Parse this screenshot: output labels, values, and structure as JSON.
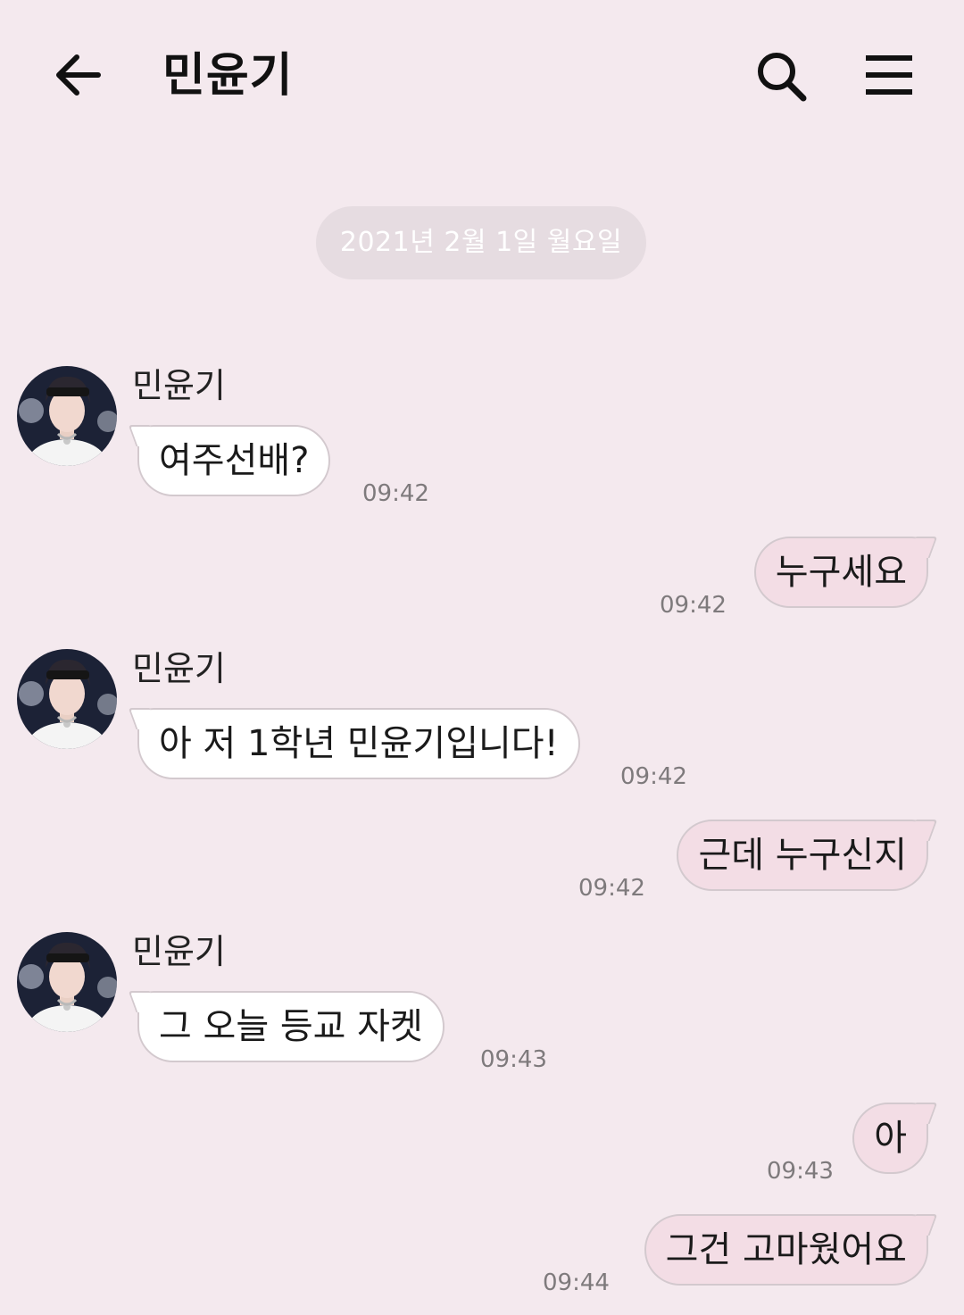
{
  "header": {
    "title": "민윤기",
    "back_icon": "arrow-left-icon",
    "search_icon": "search-icon",
    "menu_icon": "hamburger-menu-icon"
  },
  "date_divider": "2021년 2월 1일 월요일",
  "messages": [
    {
      "direction": "incoming",
      "sender": "민윤기",
      "text": "여주선배?",
      "time": "09:42"
    },
    {
      "direction": "outgoing",
      "text": "누구세요",
      "time": "09:42"
    },
    {
      "direction": "incoming",
      "sender": "민윤기",
      "text": "아 저 1학년 민윤기입니다!",
      "time": "09:42"
    },
    {
      "direction": "outgoing",
      "text": "근데 누구신지",
      "time": "09:42"
    },
    {
      "direction": "incoming",
      "sender": "민윤기",
      "text": "그 오늘 등교 자켓",
      "time": "09:43"
    },
    {
      "direction": "outgoing",
      "text": "아",
      "time": "09:43"
    },
    {
      "direction": "outgoing",
      "text": "그건 고마웠어요",
      "time": "09:44"
    }
  ],
  "colors": {
    "background": "#f4e9ee",
    "incoming_bubble": "#ffffff",
    "outgoing_bubble": "#f3dde5",
    "bubble_border": "#d3c9ce",
    "date_pill": "#e6dce1"
  }
}
